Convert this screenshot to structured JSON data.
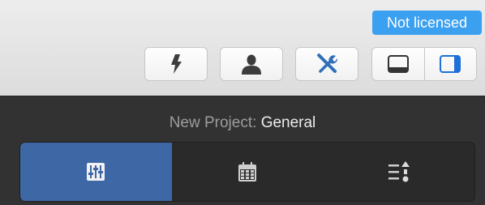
{
  "license": {
    "label": "Not licensed",
    "color": "#3aa0ef"
  },
  "toolbar": {
    "buttons": [
      {
        "icon": "lightning-icon"
      },
      {
        "icon": "person-icon"
      },
      {
        "icon": "tools-icon"
      }
    ],
    "layout_toggle": [
      {
        "icon": "bottom-panel-icon",
        "selected": false
      },
      {
        "icon": "right-panel-icon",
        "selected": true
      }
    ]
  },
  "panel": {
    "title_prefix": "New Project:",
    "title_name": "General",
    "tabs": [
      {
        "icon": "sliders-icon",
        "active": true
      },
      {
        "icon": "calendar-icon",
        "active": false
      },
      {
        "icon": "list-order-icon",
        "active": false
      }
    ],
    "accent_color": "#3e67a6"
  }
}
